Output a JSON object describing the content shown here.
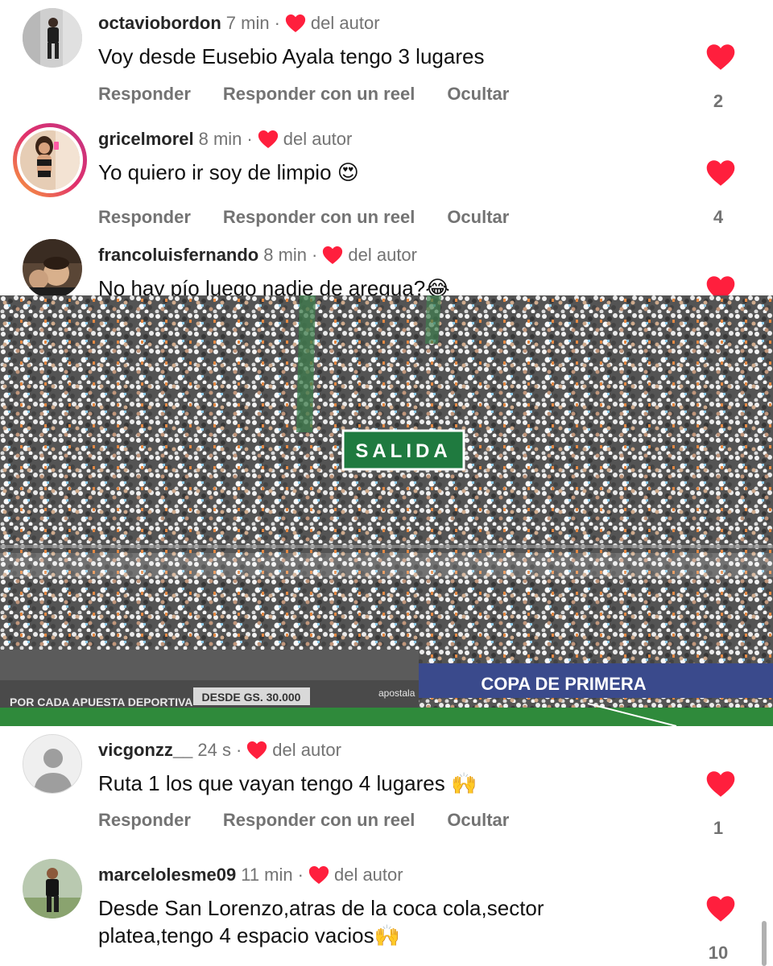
{
  "comments": [
    {
      "username": "octaviobordon",
      "time": "7 min",
      "separator": "·",
      "author_like": "del autor",
      "text": "Voy desde Eusebio Ayala tengo 3 lugares",
      "reply": "Responder",
      "reply_reel": "Responder con un reel",
      "hide": "Ocultar",
      "likes": "2"
    },
    {
      "username": "gricelmorel",
      "time": "8 min",
      "separator": "·",
      "author_like": "del autor",
      "text": "Yo quiero ir soy de limpio 😍",
      "reply": "Responder",
      "reply_reel": "Responder con un reel",
      "hide": "Ocultar",
      "likes": "4"
    },
    {
      "username": "francoluisfernando",
      "time": "8 min",
      "separator": "·",
      "author_like": "del autor",
      "text": "No hay pío luego nadie de aregua?😂"
    },
    {
      "username": "vicgonzz__",
      "time": "24 s",
      "separator": "·",
      "author_like": "del autor",
      "text": "Ruta 1 los que vayan tengo 4 lugares 🙌",
      "reply": "Responder",
      "reply_reel": "Responder con un reel",
      "hide": "Ocultar",
      "likes": "1"
    },
    {
      "username": "marcelolesme09",
      "time": "11 min",
      "separator": "·",
      "author_like": "del autor",
      "text": "Desde San Lorenzo,atras de la coca cola,sector platea,tengo 4 espacio vacios🙌",
      "likes": "10"
    }
  ],
  "photo": {
    "sign": "SALIDA",
    "ad_left": "POR CADA APUESTA DEPORTIVA",
    "ad_price": "DESDE GS. 30.000",
    "ad_brand": "apostala",
    "ad_right": "COPA DE PRIMERA"
  },
  "colors": {
    "heart": "#ff1f3d",
    "muted": "#737373",
    "pitch": "#2f8a3b"
  },
  "icons": {
    "like": "heart-icon",
    "author_like": "heart-icon",
    "default_avatar": "person-icon"
  }
}
